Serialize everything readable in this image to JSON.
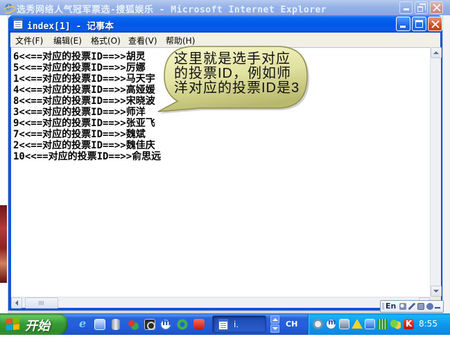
{
  "ie_window": {
    "title": "选秀网络人气冠军票选-搜狐娱乐 - Microsoft Internet Explorer",
    "icon": "ie-icon",
    "controls": [
      "minimize-icon",
      "restore-icon",
      "close-icon"
    ]
  },
  "notepad": {
    "title": "index[1] - 记事本",
    "icon": "notepad-icon",
    "controls": [
      "minimize-icon",
      "maximize-icon",
      "close-icon"
    ],
    "menu": [
      {
        "label": "文件(F)"
      },
      {
        "label": "编辑(E)"
      },
      {
        "label": "格式(O)"
      },
      {
        "label": "查看(V)"
      },
      {
        "label": "帮助(H)"
      }
    ],
    "lines": [
      "6<<==对应的投票ID==>>胡灵",
      "5<<==对应的投票ID==>>厉娜",
      "1<<==对应的投票ID==>>马天宇",
      "4<<==对应的投票ID==>>高娅媛",
      "8<<==对应的投票ID==>>宋晓波",
      "3<<==对应的投票ID==>>师洋",
      "9<<==对应的投票ID==>>张亚飞",
      "7<<==对应的投票ID==>>魏斌",
      "2<<==对应的投票ID==>>魏佳庆",
      "10<<==对应的投票ID==>>俞思远"
    ]
  },
  "callout": {
    "lines": [
      "这里就是选手对应",
      "的投票ID，例如师",
      "洋对应的投票ID是3"
    ]
  },
  "language_bar": {
    "label": "En",
    "icons": [
      "ime-icon",
      "pen-icon",
      "keyboard-icon",
      "help-icon",
      "options-icon"
    ]
  },
  "taskbar": {
    "start_label": "开始",
    "start_icon": "windows-logo-icon",
    "quick_launch": [
      "ie-icon",
      "desktop-icon",
      "disk-icon",
      "bird-icon",
      "camera-icon",
      "m-logo-icon",
      "recycle-icon",
      "red-app-icon"
    ],
    "task_button": {
      "label": "i.",
      "icon": "notepad-icon"
    },
    "input_language": "CH",
    "tray_icons": [
      "network-icon",
      "m-logo-icon",
      "monitor-icon",
      "warning-icon",
      "network-connection-icon",
      "grid-icon",
      "chat-icon",
      "k-logo-icon"
    ],
    "clock": "8:55"
  },
  "colors": {
    "notepad_title_bar": "#0058e8",
    "ie_title_bar_inactive": "#98b2e8",
    "menu_bar": "#f1efe6",
    "callout_fill": "#e3e3a4",
    "callout_border": "#8e8e4e",
    "taskbar": "#245edb",
    "start_button": "#389e35",
    "tray": "#0e99ec",
    "close_button": "#d1461f"
  }
}
